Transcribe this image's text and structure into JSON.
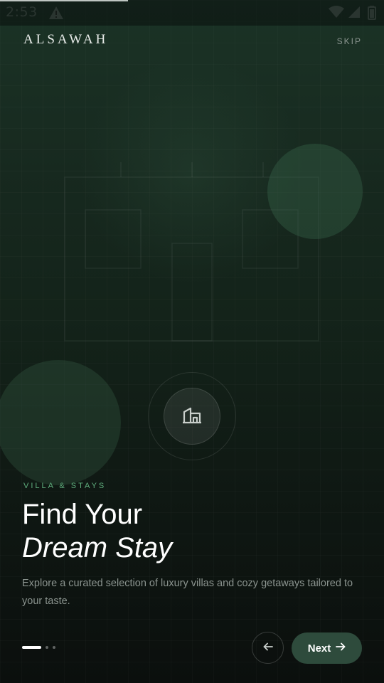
{
  "status_bar": {
    "time": "2:53",
    "icons": [
      "warning-icon",
      "wifi-icon",
      "signal-icon",
      "battery-icon"
    ]
  },
  "header": {
    "brand": "ALSAWAH",
    "skip_label": "SKIP"
  },
  "hero": {
    "illustration": "house-outline",
    "center_icon": "building-icon"
  },
  "content": {
    "category": "VILLA & STAYS",
    "title_line1": "Find Your",
    "title_line2": "Dream Stay",
    "description": "Explore a curated selection of luxury villas and cozy getaways tailored to your taste."
  },
  "pagination": {
    "total": 3,
    "active_index": 0
  },
  "navigation": {
    "back_icon": "arrow-left-icon",
    "next_label": "Next",
    "next_icon": "arrow-right-icon"
  },
  "colors": {
    "accent": "#5fae7d",
    "button": "#2e4b3c",
    "background": "#132219"
  }
}
